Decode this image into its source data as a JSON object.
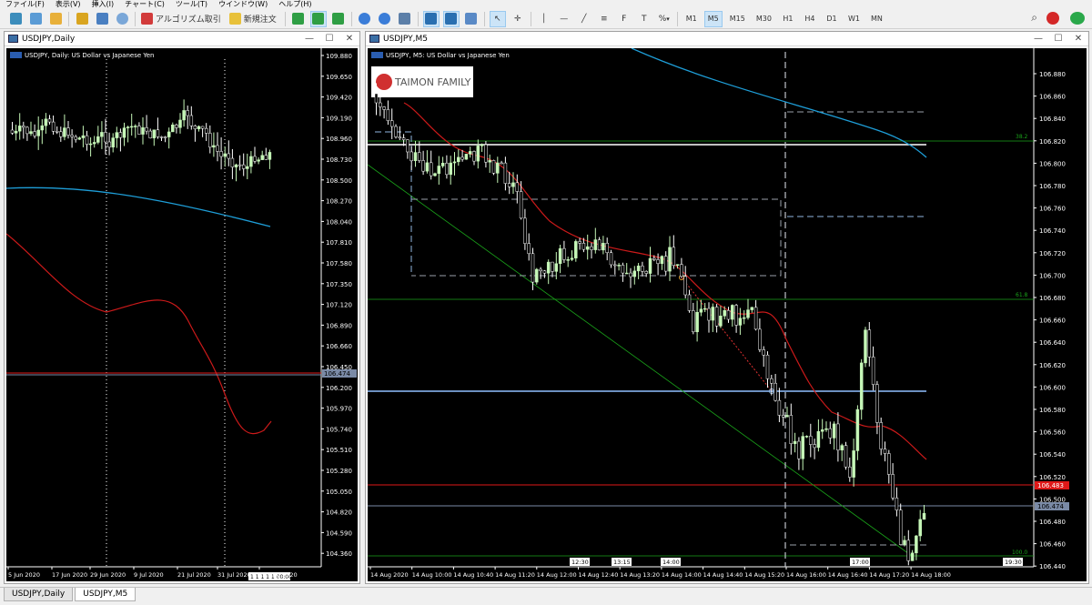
{
  "menu": [
    "ファイル(F)",
    "表示(V)",
    "挿入(I)",
    "チャート(C)",
    "ツール(T)",
    "ウインドウ(W)",
    "ヘルプ(H)"
  ],
  "toolbar": {
    "algo_label": "アルゴリズム取引",
    "new_order_label": "新規注文",
    "timeframes": [
      "M1",
      "M5",
      "M15",
      "M30",
      "H1",
      "H4",
      "D1",
      "W1",
      "MN"
    ],
    "active_timeframe": "M5",
    "percent_label": "%"
  },
  "daily": {
    "window_title": "USDJPY,Daily",
    "header": "USDJPY, Daily:  US Dollar vs Japanese Yen",
    "price_labels": [
      "109.880",
      "109.650",
      "109.420",
      "109.190",
      "108.960",
      "108.730",
      "108.500",
      "108.270",
      "108.040",
      "107.810",
      "107.580",
      "107.350",
      "107.120",
      "106.890",
      "106.660",
      "106.450",
      "106.200",
      "105.970",
      "105.740",
      "105.510",
      "105.280",
      "105.050",
      "104.820",
      "104.590",
      "104.360"
    ],
    "current_price": "106.474",
    "time_labels": [
      "5 Jun 2020",
      "17 Jun 2020",
      "29 Jun 2020",
      "9 Jul 2020",
      "21 Jul 2020",
      "31 Jul 2020",
      "12 Aug 2020"
    ],
    "countdown": "1 1 1 1 1 00:00"
  },
  "m5": {
    "window_title": "USDJPY,M5",
    "header": "USDJPY, M5:  US Dollar vs Japanese Yen",
    "logo_text": "TAIMON FAMILY",
    "price_labels": [
      "106.880",
      "106.860",
      "106.840",
      "106.820",
      "106.800",
      "106.780",
      "106.760",
      "106.740",
      "106.720",
      "106.700",
      "106.680",
      "106.660",
      "106.640",
      "106.620",
      "106.600",
      "106.580",
      "106.560",
      "106.540",
      "106.520",
      "106.500",
      "106.480",
      "106.460",
      "106.440"
    ],
    "red_line_label": "106.483",
    "gray_line_label": "106.474",
    "fib_labels": [
      "38.2",
      "61.8",
      "100.0"
    ],
    "time_labels": [
      "14 Aug 2020",
      "14 Aug 10:00",
      "14 Aug 10:40",
      "14 Aug 11:20",
      "14 Aug 12:00",
      "14 Aug 12:40",
      "14 Aug 13:20",
      "14 Aug 14:00",
      "14 Aug 14:40",
      "14 Aug 15:20",
      "14 Aug 16:00",
      "14 Aug 16:40",
      "14 Aug 17:20",
      "14 Aug 18:00"
    ],
    "box_time_labels": [
      "12:30",
      "13:15",
      "14:00",
      "17:00",
      "19:30"
    ]
  },
  "tabs": [
    "USDJPY,Daily",
    "USDJPY,M5"
  ],
  "active_tab": "USDJPY,M5",
  "colors": {
    "bull": "#c6f7b8",
    "ma_red": "#cc1a1a",
    "ma_blue": "#1e9ed8",
    "fib": "#1aa31a",
    "hline_red": "#e01818",
    "hline_blue": "#8fbfff"
  }
}
